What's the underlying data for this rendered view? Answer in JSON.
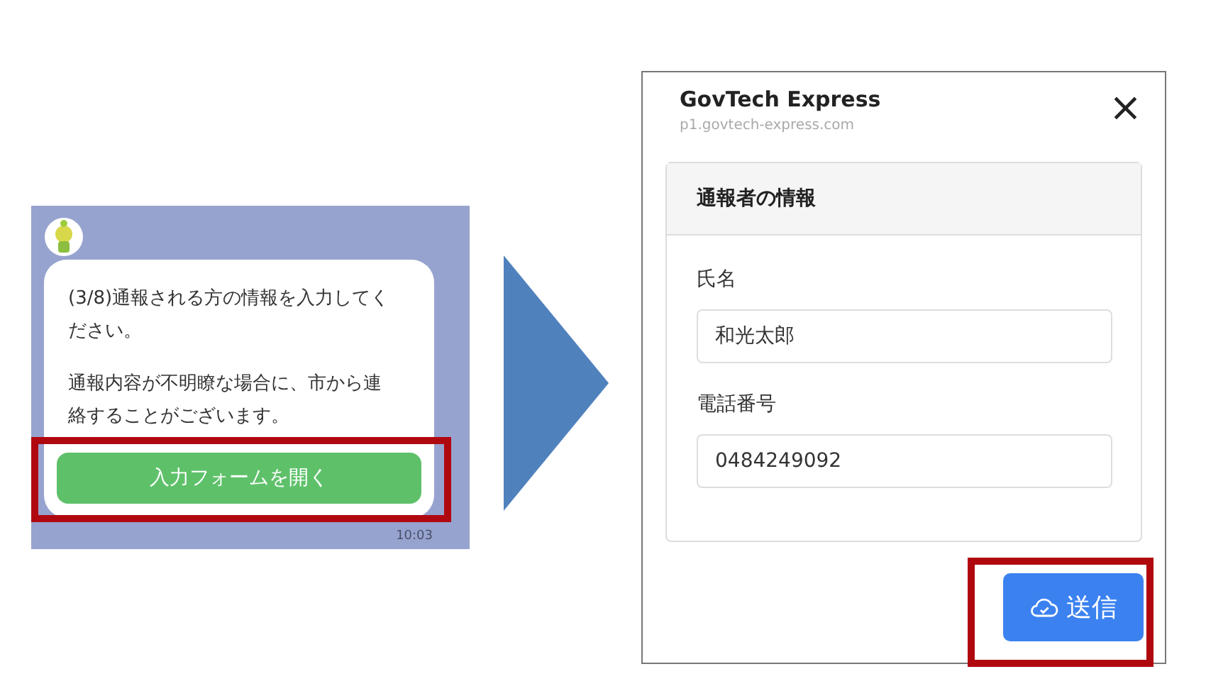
{
  "chat": {
    "paragraphs": [
      "(3/8)通報される方の情報を入力してください。",
      "通報内容が不明瞭な場合に、市から連絡することがございます。"
    ],
    "button": "入力フォームを開く",
    "time": "10:03"
  },
  "form": {
    "title": "GovTech Express",
    "url": "p1.govtech-express.com",
    "close": "×",
    "section": "通報者の情報",
    "fields": [
      {
        "label": "氏名",
        "value": "和光太郎"
      },
      {
        "label": "電話番号",
        "value": "0484249092"
      }
    ],
    "submit": "送信"
  }
}
